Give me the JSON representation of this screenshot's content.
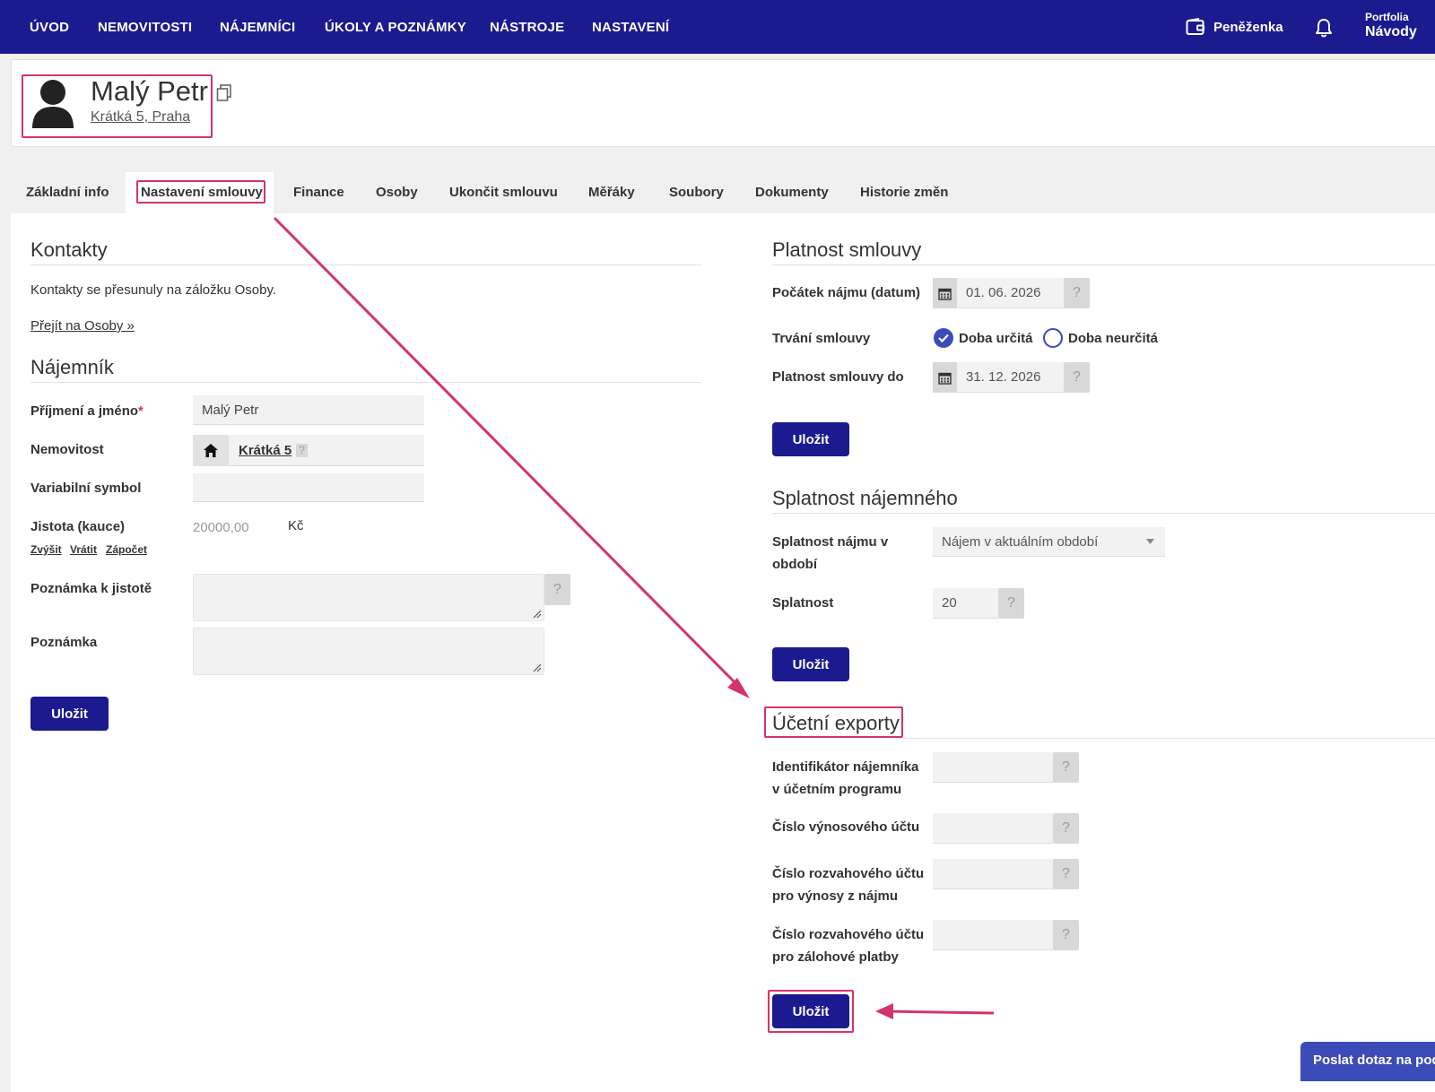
{
  "nav": {
    "items": [
      "ÚVOD",
      "NEMOVITOSTI",
      "NÁJEMNÍCI",
      "ÚKOLY A POZNÁMKY",
      "NÁSTROJE",
      "NASTAVENÍ"
    ],
    "wallet_label": "Peněženka",
    "portfolio_small": "Portfolia",
    "portfolio_name": "Návody"
  },
  "tenant": {
    "name": "Malý Petr",
    "address": "Krátká 5, Praha"
  },
  "tabs": [
    "Základní info",
    "Nastavení smlouvy",
    "Finance",
    "Osoby",
    "Ukončit smlouvu",
    "Měřáky",
    "Soubory",
    "Dokumenty",
    "Historie změn"
  ],
  "active_tab": "Nastavení smlouvy",
  "contacts": {
    "title": "Kontakty",
    "text": "Kontakty se přesunuly na záložku Osoby.",
    "link": "Přejít na Osoby »"
  },
  "tenant_section": {
    "title": "Nájemník",
    "name_label": "Příjmení a jméno",
    "required_mark": "*",
    "name_value": "Malý Petr",
    "property_label": "Nemovitost",
    "property_value": "Krátká 5",
    "property_help": "?",
    "vs_label": "Variabilní symbol",
    "vs_value": "",
    "deposit_label": "Jistota (kauce)",
    "deposit_value": "20000,00",
    "deposit_currency": "Kč",
    "deposit_actions": [
      "Zvýšit",
      "Vrátit",
      "Zápočet"
    ],
    "deposit_note_label": "Poznámka k jistotě",
    "note_label": "Poznámka",
    "help": "?",
    "save": "Uložit"
  },
  "validity": {
    "title": "Platnost smlouvy",
    "start_label": "Počátek nájmu (datum)",
    "start_value": "01. 06. 2026",
    "duration_label": "Trvání smlouvy",
    "duration_option_definite": "Doba určitá",
    "duration_option_indefinite": "Doba neurčitá",
    "duration_selected": "Doba určitá",
    "end_label": "Platnost smlouvy do",
    "end_value": "31. 12. 2026",
    "help": "?",
    "save": "Uložit"
  },
  "due": {
    "title": "Splatnost nájemného",
    "period_label": "Splatnost nájmu v období",
    "period_value": "Nájem v aktuálním období",
    "due_label": "Splatnost",
    "due_value": "20",
    "help": "?",
    "save": "Uložit"
  },
  "exports": {
    "title": "Účetní exporty",
    "fields": [
      {
        "label": "Identifikátor nájemníka v účetním programu",
        "value": ""
      },
      {
        "label": "Číslo výnosového účtu",
        "value": ""
      },
      {
        "label": "Číslo rozvahového účtu pro výnosy z nájmu",
        "value": ""
      },
      {
        "label": "Číslo rozvahového účtu pro zálohové platby",
        "value": ""
      }
    ],
    "help": "?",
    "save": "Uložit"
  },
  "help_chat": "Poslat dotaz na podporu",
  "colors": {
    "nav_bg": "#1b1a8f",
    "primary_button": "#1b1a8f",
    "highlight": "#d6336c",
    "radio": "#3b4bb8"
  }
}
